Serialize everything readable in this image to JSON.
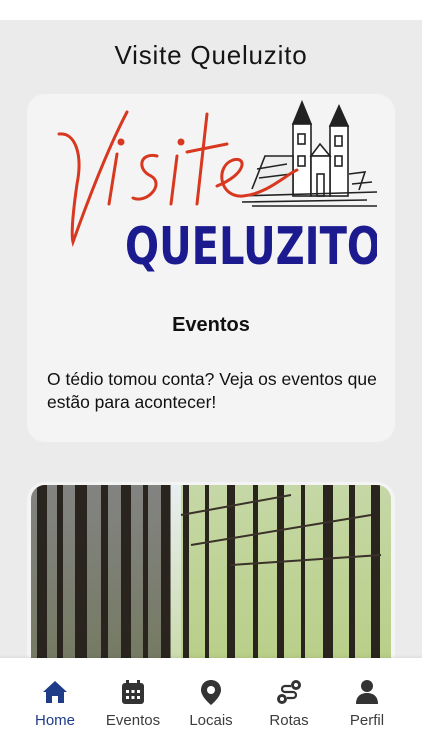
{
  "header": {
    "title": "Visite Queluzito"
  },
  "card": {
    "title": "Eventos",
    "description": "O tédio tomou conta? Veja os eventos que estão para acontecer!",
    "logo": {
      "script_text": "Visite",
      "block_text": "QUELUZITO"
    }
  },
  "tabs": [
    {
      "label": "Home",
      "icon": "home-icon",
      "active": true
    },
    {
      "label": "Eventos",
      "icon": "calendar-icon",
      "active": false
    },
    {
      "label": "Locais",
      "icon": "map-pin-icon",
      "active": false
    },
    {
      "label": "Rotas",
      "icon": "route-icon",
      "active": false
    },
    {
      "label": "Perfil",
      "icon": "user-icon",
      "active": false
    }
  ],
  "colors": {
    "active_tab": "#1f3c88",
    "inactive_tab": "#3c3c3c",
    "logo_red": "#d8381f",
    "logo_blue": "#1b1a8f"
  }
}
